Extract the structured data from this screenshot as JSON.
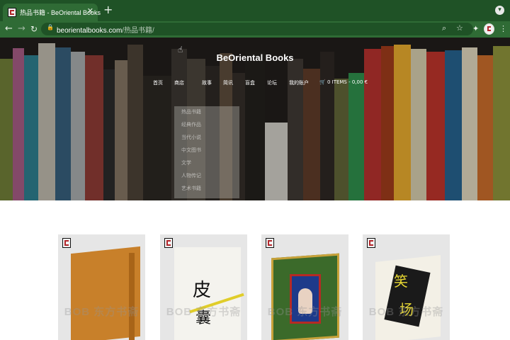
{
  "browser": {
    "tab_title": "热品书籍 - BeOriental Books",
    "tab_close": "✕",
    "new_tab": "+",
    "url_host": "beorientalbooks.com",
    "url_path": "/热品书籍/",
    "back": "←",
    "forward": "→",
    "reload": "↻",
    "lock": "🔒",
    "search_icon": "⌕",
    "star_icon": "☆",
    "extensions_icon": "✦",
    "menu_icon": "⋮",
    "profile_icon": "▾"
  },
  "site": {
    "title": "BeOriental Books",
    "nav": [
      {
        "label": "首页"
      },
      {
        "label": "商店"
      },
      {
        "label": "故事"
      },
      {
        "label": "简讯"
      },
      {
        "label": "盲盒"
      },
      {
        "label": "论坛"
      },
      {
        "label": "我的账户"
      }
    ],
    "cart": {
      "icon": "🛒",
      "label": "0 ITEMS - 0,00 €"
    },
    "dropdown": [
      "热品书籍",
      "经典作品",
      "当代小说",
      "中文图书",
      "文学",
      "人物传记",
      "艺术书籍"
    ]
  },
  "products": [
    {
      "watermark": "BOB 东方书斋"
    },
    {
      "watermark": "BOB 东方书斋",
      "cover_title": "皮",
      "cover_title2": "囊"
    },
    {
      "watermark": "BOB 东方书斋"
    },
    {
      "watermark": "BOB 东方书斋",
      "cover_title": "笑",
      "cover_title2": "场"
    }
  ],
  "colors": {
    "tab_bar": "#1f5226",
    "toolbar": "#2f6b35",
    "logo_red": "#b3262b"
  }
}
